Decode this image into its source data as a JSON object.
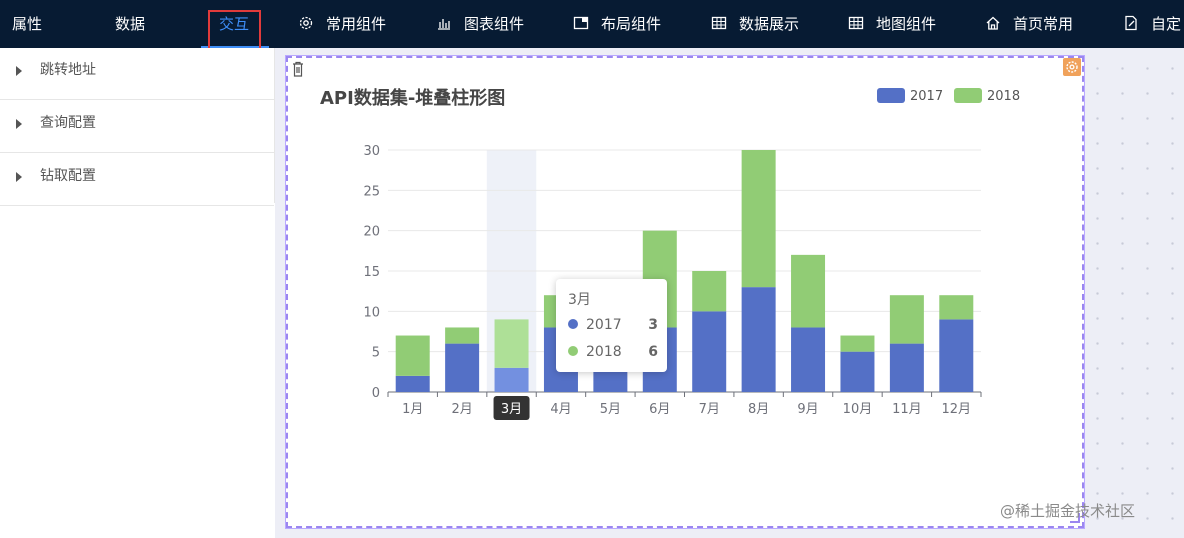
{
  "tabs": [
    {
      "label": "属性",
      "active": false
    },
    {
      "label": "数据",
      "active": false
    },
    {
      "label": "交互",
      "active": true
    }
  ],
  "nav_items": [
    {
      "label": "常用组件",
      "icon": "gear-icon"
    },
    {
      "label": "图表组件",
      "icon": "bar-chart-icon"
    },
    {
      "label": "布局组件",
      "icon": "layout-icon"
    },
    {
      "label": "数据展示",
      "icon": "table-icon"
    },
    {
      "label": "地图组件",
      "icon": "table-icon"
    },
    {
      "label": "首页常用",
      "icon": "home-icon"
    },
    {
      "label": "自定",
      "icon": "edit-icon"
    }
  ],
  "left_panel": {
    "items": [
      {
        "label": "跳转地址"
      },
      {
        "label": "查询配置"
      },
      {
        "label": "钻取配置"
      }
    ]
  },
  "colors": {
    "topbar_bg": "#071b33",
    "accent": "#3e8ef7",
    "highlight_box": "#e13b3b",
    "series_2017": "#5470c6",
    "series_2018": "#91cc75",
    "selection_border": "#9b86f0"
  },
  "chart_data": {
    "type": "bar",
    "stacked": true,
    "title": "API数据集-堆叠柱形图",
    "categories": [
      "1月",
      "2月",
      "3月",
      "4月",
      "5月",
      "6月",
      "7月",
      "8月",
      "9月",
      "10月",
      "11月",
      "12月"
    ],
    "series": [
      {
        "name": "2017",
        "color": "#5470c6",
        "values": [
          2,
          6,
          3,
          8,
          3,
          8,
          10,
          13,
          8,
          5,
          6,
          9
        ]
      },
      {
        "name": "2018",
        "color": "#91cc75",
        "values": [
          5,
          2,
          6,
          4,
          2,
          12,
          5,
          17,
          9,
          2,
          6,
          3
        ]
      }
    ],
    "ylim": [
      0,
      30
    ],
    "yticks": [
      0,
      5,
      10,
      15,
      20,
      25,
      30
    ],
    "legend_position": "top-right",
    "grid": true,
    "highlighted_category": "3月"
  },
  "tooltip": {
    "title": "3月",
    "rows": [
      {
        "name": "2017",
        "value": "3",
        "color": "#5470c6"
      },
      {
        "name": "2018",
        "value": "6",
        "color": "#91cc75"
      }
    ]
  },
  "watermark": "@稀土掘金技术社区"
}
